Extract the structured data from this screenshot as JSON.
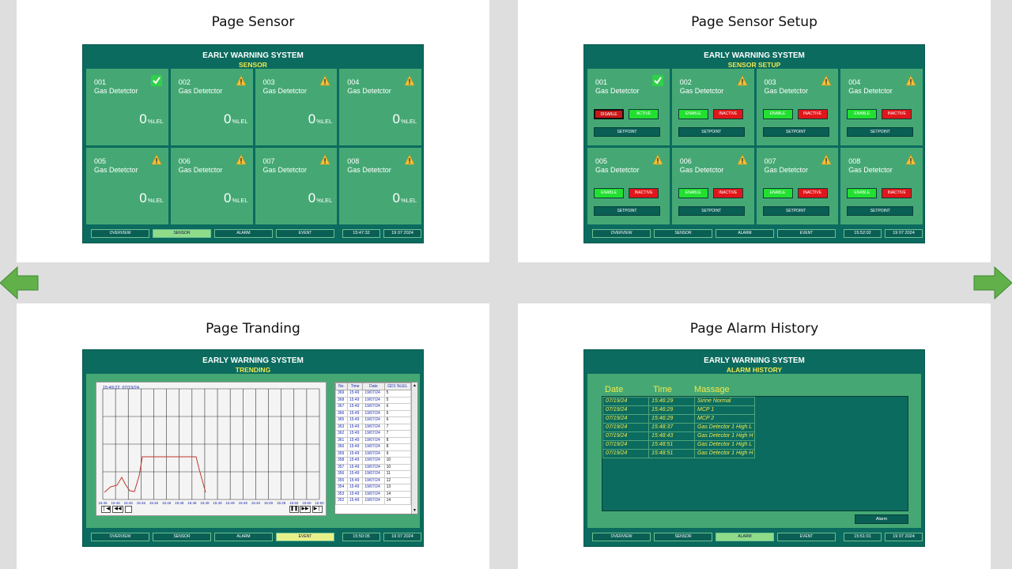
{
  "quadrants": {
    "sensor": {
      "title": "Page Sensor"
    },
    "setup": {
      "title": "Page Sensor Setup"
    },
    "trending": {
      "title": "Page Tranding"
    },
    "alarm": {
      "title": "Page Alarm History"
    }
  },
  "system_title": "EARLY WARNING SYSTEM",
  "subtitles": {
    "sensor": "SENSOR",
    "setup": "SENSOR SETUP",
    "trending": "TRENDING",
    "alarm": "ALARM HISTORY"
  },
  "sensor_label": "Gas Detetctor",
  "sensor_unit": "%LEL",
  "sensors": [
    {
      "id": "001",
      "value": "0",
      "status_icon": "check-icon"
    },
    {
      "id": "002",
      "value": "0",
      "status_icon": "warning-icon"
    },
    {
      "id": "003",
      "value": "0",
      "status_icon": "warning-icon"
    },
    {
      "id": "004",
      "value": "0",
      "status_icon": "warning-icon"
    },
    {
      "id": "005",
      "value": "0",
      "status_icon": "warning-icon"
    },
    {
      "id": "006",
      "value": "0",
      "status_icon": "warning-icon"
    },
    {
      "id": "007",
      "value": "0",
      "status_icon": "warning-icon"
    },
    {
      "id": "008",
      "value": "0",
      "status_icon": "warning-icon"
    }
  ],
  "setup_buttons": {
    "first": {
      "left": "DISABLE",
      "right": "ACTIVE"
    },
    "others": {
      "left": "ENABLE",
      "right": "INACTIVE"
    },
    "setpoint": "SETPOINT"
  },
  "nav": {
    "overview": "OVERVIEW",
    "sensor": "SENSOR",
    "alarm": "ALARM",
    "event": "EVENT"
  },
  "footers": {
    "sensor": {
      "time": "15:47:32",
      "date": "19 07 2024"
    },
    "setup": {
      "time": "15:52:02",
      "date": "19 07 2024"
    },
    "trending": {
      "time": "15:50:05",
      "date": "19 07 2024"
    },
    "alarm": {
      "time": "15:51:01",
      "date": "19 07 2024"
    }
  },
  "trend": {
    "readout": "15:49:22  07/19/24",
    "x_ticks": [
      "15:46",
      "15:46",
      "15:46",
      "15:46",
      "15:46",
      "15:46",
      "15:48",
      "15:48",
      "15:49",
      "15:49",
      "15:49",
      "15:49",
      "15:49",
      "15:49",
      "15:49",
      "15:50",
      "15:50",
      "15:50"
    ],
    "table_headers": [
      "No.",
      "Time",
      "Date",
      "GD1 %LEL"
    ],
    "table_rows": [
      [
        "369",
        "15:49",
        "19/07/24",
        "5"
      ],
      [
        "368",
        "15:49",
        "19/07/24",
        "5"
      ],
      [
        "367",
        "15:49",
        "19/07/24",
        "6"
      ],
      [
        "366",
        "15:49",
        "19/07/24",
        "6"
      ],
      [
        "365",
        "15:49",
        "19/07/24",
        "6"
      ],
      [
        "363",
        "15:49",
        "19/07/24",
        "7"
      ],
      [
        "362",
        "15:49",
        "19/07/24",
        "7"
      ],
      [
        "361",
        "15:49",
        "19/07/24",
        "8"
      ],
      [
        "360",
        "15:49",
        "19/07/24",
        "8"
      ],
      [
        "359",
        "15:49",
        "19/07/24",
        "9"
      ],
      [
        "358",
        "15:49",
        "19/07/24",
        "10"
      ],
      [
        "357",
        "15:49",
        "19/07/24",
        "10"
      ],
      [
        "356",
        "15:49",
        "19/07/24",
        "11"
      ],
      [
        "355",
        "15:49",
        "19/07/24",
        "12"
      ],
      [
        "354",
        "15:49",
        "19/07/24",
        "13"
      ],
      [
        "353",
        "15:49",
        "19/07/24",
        "14"
      ],
      [
        "352",
        "15:49",
        "19/07/24",
        "14"
      ]
    ]
  },
  "alarm_history": {
    "headers": {
      "date": "Date",
      "time": "Time",
      "message": "Massage"
    },
    "rows": [
      {
        "date": "07/19/24",
        "time": "15:46:29",
        "message": "Sirine Normal"
      },
      {
        "date": "07/19/24",
        "time": "15:46:29",
        "message": "MCP 1"
      },
      {
        "date": "07/19/24",
        "time": "15:46:29",
        "message": "MCP 2"
      },
      {
        "date": "07/19/24",
        "time": "15:48:37",
        "message": "Gas Detector 1 High L"
      },
      {
        "date": "07/19/24",
        "time": "15:48:43",
        "message": "Gas Detector 1 High H"
      },
      {
        "date": "07/19/24",
        "time": "15:48:51",
        "message": "Gas Detector 1 High L"
      },
      {
        "date": "07/19/24",
        "time": "15:48:51",
        "message": "Gas Detector 1 High H"
      }
    ],
    "button": "Alarm"
  },
  "colors": {
    "panel": "#0b6b5f",
    "cell": "#45a874",
    "subtitle": "#f2e84b",
    "arrow": "#62b04a"
  }
}
